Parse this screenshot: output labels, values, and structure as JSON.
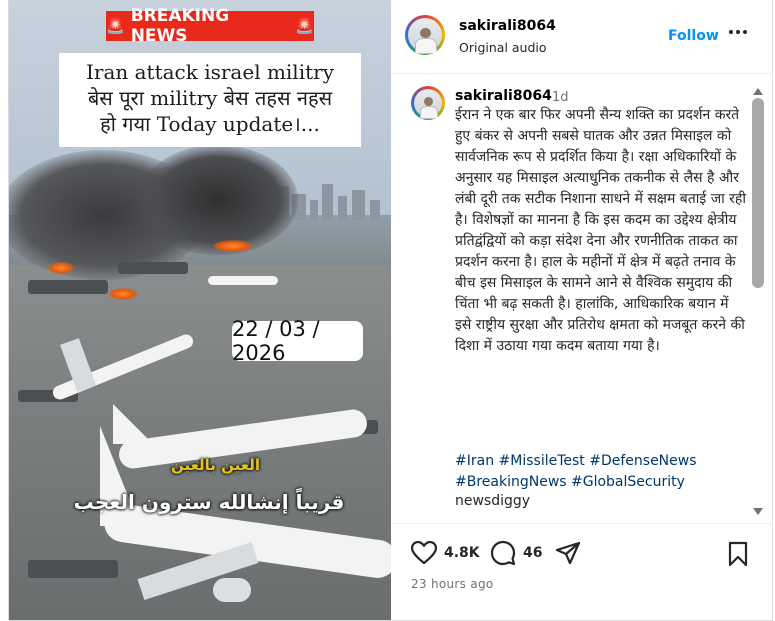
{
  "media": {
    "breaking_label": "BREAKING NEWS",
    "headline": "Iran attack israel militry\nबेस पूरा militry बेस तहस नहस\nहो गया Today update।...",
    "date": "22 / 03 / 2026",
    "arabic_line1": "العين بالعين",
    "arabic_line2": "قريباً إنشالله سترون العجب"
  },
  "header": {
    "username": "sakirali8064",
    "audio": "Original audio",
    "follow_label": "Follow",
    "more_label": "•••"
  },
  "post": {
    "username": "sakirali8064",
    "time": "1d",
    "caption": "ईरान ने एक बार फिर अपनी सैन्य शक्ति का प्रदर्शन करते हुए बंकर से अपनी सबसे घातक और उन्नत मिसाइल को सार्वजनिक रूप से प्रदर्शित किया है। रक्षा अधिकारियों के अनुसार यह मिसाइल अत्याधुनिक तकनीक से लैस है और लंबी दूरी तक सटीक निशाना साधने में सक्षम बताई जा रही है। विशेषज्ञों का मानना है कि इस कदम का उद्देश्य क्षेत्रीय प्रतिद्वंद्वियों को कड़ा संदेश देना और रणनीतिक ताकत का प्रदर्शन करना है। हाल के महीनों में क्षेत्र में बढ़ते तनाव के बीच इस मिसाइल के सामने आने से वैश्विक समुदाय की चिंता भी बढ़ सकती है। हालांकि, आधिकारिक बयान में इसे राष्ट्रीय सुरक्षा और प्रतिरोध क्षमता को मजबूत करने की दिशा में उठाया गया कदम बताया गया है।",
    "hashtags": [
      "#Iran",
      "#MissileTest",
      "#DefenseNews",
      "#BreakingNews",
      "#GlobalSecurity"
    ],
    "credit": "newsdiggy"
  },
  "actions": {
    "likes": "4.8K",
    "comments": "46",
    "time_ago": "23 hours ago"
  },
  "colors": {
    "link_blue": "#0095f6",
    "hashtag": "#00376b",
    "breaking_red": "#e8291c"
  }
}
